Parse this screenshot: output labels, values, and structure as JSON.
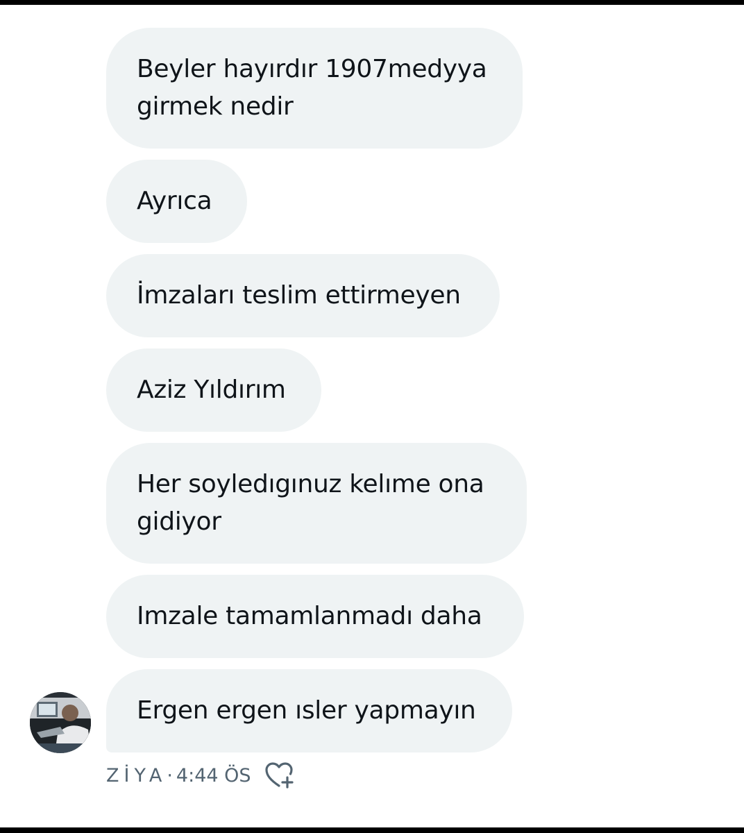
{
  "messages": [
    {
      "text": "Beyler hayırdır 1907medyya girmek nedir"
    },
    {
      "text": "Ayrıca"
    },
    {
      "text": "İmzaları teslim ettirmeyen"
    },
    {
      "text": "Aziz Yıldırım"
    },
    {
      "text": "Her soyledıgınuz kelıme ona gidiyor"
    },
    {
      "text": "Imzale tamamlanmadı daha"
    },
    {
      "text": "Ergen ergen ısler yapmayın"
    }
  ],
  "meta": {
    "sender": "ZİYA",
    "separator": "·",
    "time": "4:44 ÖS",
    "react_icon": "heart-plus-icon"
  },
  "colors": {
    "bubble_bg": "#eff3f4",
    "text": "#0f1419",
    "meta_text": "#536471",
    "frame": "#000000"
  }
}
